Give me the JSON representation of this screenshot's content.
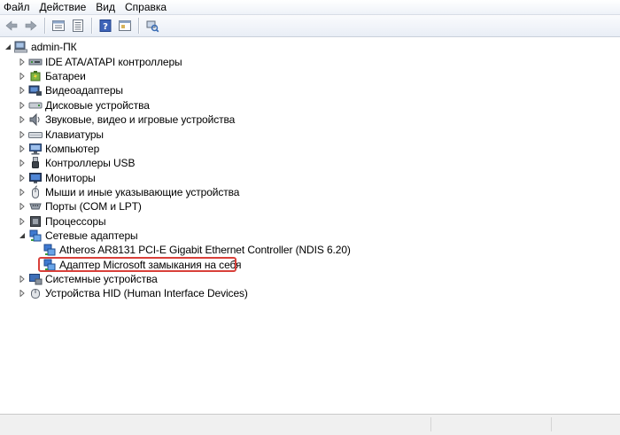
{
  "menubar": {
    "items": [
      {
        "label": "Файл"
      },
      {
        "label": "Действие"
      },
      {
        "label": "Вид"
      },
      {
        "label": "Справка"
      }
    ]
  },
  "toolbar": {
    "buttons": [
      {
        "icon": "back-arrow-icon"
      },
      {
        "icon": "forward-arrow-icon"
      },
      {
        "icon": "properties-icon"
      },
      {
        "icon": "list-view-icon"
      },
      {
        "icon": "help-icon"
      },
      {
        "icon": "device-window-icon"
      },
      {
        "icon": "scan-hardware-icon"
      }
    ]
  },
  "tree": {
    "root": {
      "label": "admin-ПК",
      "icon": "computer-root-icon",
      "expanded": true
    },
    "categories": [
      {
        "label": "IDE ATA/ATAPI контроллеры",
        "icon": "ide-controller-icon",
        "expanded": false
      },
      {
        "label": "Батареи",
        "icon": "battery-icon",
        "expanded": false
      },
      {
        "label": "Видеоадаптеры",
        "icon": "display-adapter-icon",
        "expanded": false
      },
      {
        "label": "Дисковые устройства",
        "icon": "disk-drive-icon",
        "expanded": false
      },
      {
        "label": "Звуковые, видео и игровые устройства",
        "icon": "speaker-icon",
        "expanded": false
      },
      {
        "label": "Клавиатуры",
        "icon": "keyboard-icon",
        "expanded": false
      },
      {
        "label": "Компьютер",
        "icon": "computer-icon",
        "expanded": false
      },
      {
        "label": "Контроллеры USB",
        "icon": "usb-icon",
        "expanded": false
      },
      {
        "label": "Мониторы",
        "icon": "monitor-icon",
        "expanded": false
      },
      {
        "label": "Мыши и иные указывающие устройства",
        "icon": "mouse-icon",
        "expanded": false
      },
      {
        "label": "Порты (COM и LPT)",
        "icon": "port-icon",
        "expanded": false
      },
      {
        "label": "Процессоры",
        "icon": "processor-icon",
        "expanded": false
      },
      {
        "label": "Сетевые адаптеры",
        "icon": "network-adapter-icon",
        "expanded": true
      },
      {
        "label": "Системные устройства",
        "icon": "system-device-icon",
        "expanded": false
      },
      {
        "label": "Устройства HID (Human Interface Devices)",
        "icon": "hid-icon",
        "expanded": false
      }
    ],
    "network_children": [
      {
        "label": "Atheros AR8131 PCI-E Gigabit Ethernet Controller (NDIS 6.20)",
        "icon": "network-adapter-icon"
      },
      {
        "label": "Адаптер Microsoft замыкания на себя",
        "icon": "network-adapter-icon",
        "highlighted": true
      }
    ]
  },
  "colors": {
    "highlight_border": "#d9403a",
    "menubar_bg": "#eef2f8",
    "statusbar_bg": "#f0f0f0"
  }
}
